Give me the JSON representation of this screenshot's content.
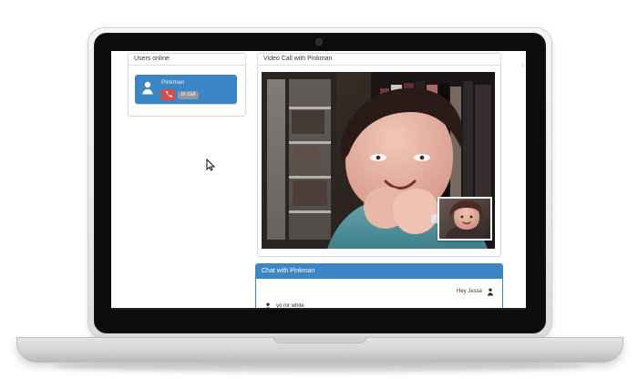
{
  "users": {
    "title": "Users online",
    "items": [
      {
        "name": "Pinkman",
        "status": "in call"
      }
    ]
  },
  "video": {
    "title": "Video Call with Pinkman"
  },
  "chat": {
    "title": "Chat with Pinkman",
    "messages": [
      {
        "text": "Hey Jesse",
        "align": "right"
      },
      {
        "text": "yo mr white",
        "align": "left"
      }
    ]
  },
  "colors": {
    "accent": "#3d86c6",
    "call_button": "#d84b46",
    "badge": "#8f9aa5"
  },
  "icons": {
    "user_avatar": "user-silhouette-icon",
    "call": "phone-icon",
    "cursor": "mouse-cursor-icon",
    "chat_user": "user-silhouette-icon"
  }
}
